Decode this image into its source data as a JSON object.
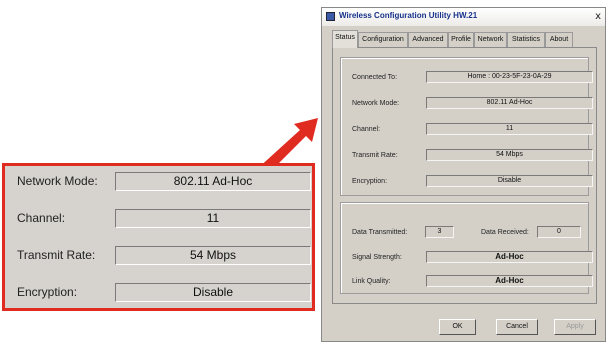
{
  "callout": {
    "rows": [
      {
        "label": "Network Mode:",
        "value": "802.11 Ad-Hoc"
      },
      {
        "label": "Channel:",
        "value": "11"
      },
      {
        "label": "Transmit Rate:",
        "value": "54 Mbps"
      },
      {
        "label": "Encryption:",
        "value": "Disable"
      }
    ],
    "border_color": "#e02b20"
  },
  "window": {
    "title": "Wireless Configuration Utility HW.21",
    "close_glyph": "x",
    "tabs": [
      "Status",
      "Configuration",
      "Advanced",
      "Profile",
      "Network",
      "Statistics",
      "About"
    ],
    "active_tab": "Status",
    "status": {
      "connected_to": {
        "label": "Connected To:",
        "value": "Home : 00-23-5F-23-0A-29"
      },
      "network_mode": {
        "label": "Network Mode:",
        "value": "802.11 Ad-Hoc"
      },
      "channel": {
        "label": "Channel:",
        "value": "11"
      },
      "transmit_rate": {
        "label": "Transmit Rate:",
        "value": "54 Mbps"
      },
      "encryption": {
        "label": "Encryption:",
        "value": "Disable"
      }
    },
    "stats": {
      "data_transmitted": {
        "label": "Data Transmitted:",
        "value": "3"
      },
      "data_received": {
        "label": "Data Received:",
        "value": "0"
      },
      "signal_strength": {
        "label": "Signal Strength:",
        "value": "Ad-Hoc"
      },
      "link_quality": {
        "label": "Link Quality:",
        "value": "Ad-Hoc"
      }
    },
    "buttons": {
      "ok": "OK",
      "cancel": "Cancel",
      "apply": "Apply"
    }
  }
}
